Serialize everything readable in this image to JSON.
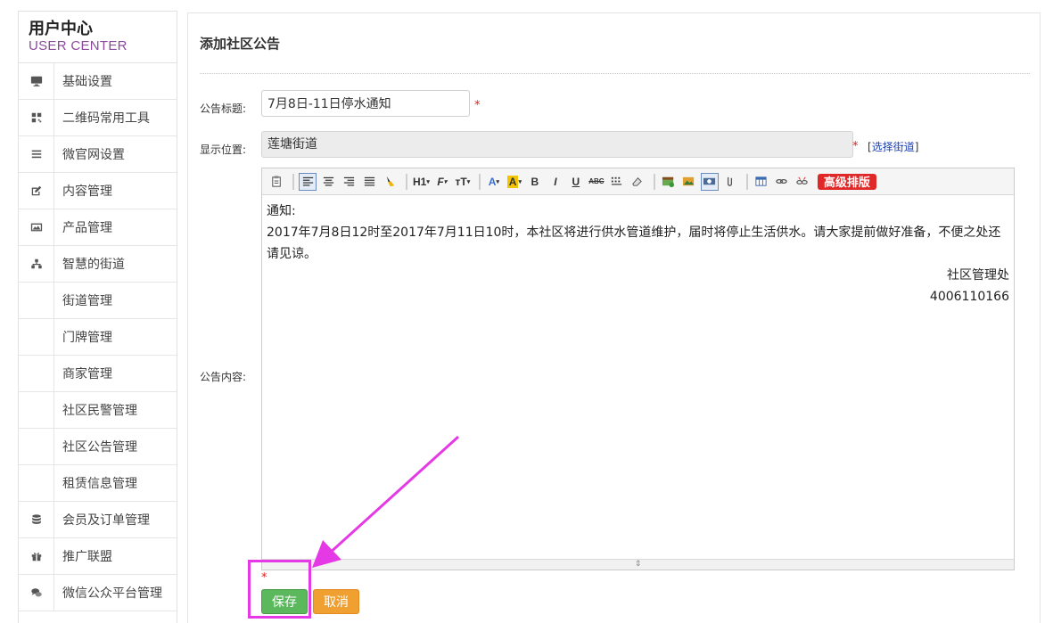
{
  "sidebar": {
    "logo_cn": "用户中心",
    "logo_en": "USER CENTER",
    "items": [
      {
        "label": "基础设置",
        "icon": "monitor-icon"
      },
      {
        "label": "二维码常用工具",
        "icon": "qrcode-icon"
      },
      {
        "label": "微官网设置",
        "icon": "list-icon"
      },
      {
        "label": "内容管理",
        "icon": "edit-icon"
      },
      {
        "label": "产品管理",
        "icon": "image-icon"
      },
      {
        "label": "智慧的街道",
        "icon": "sitemap-icon"
      },
      {
        "label": "街道管理"
      },
      {
        "label": "门牌管理"
      },
      {
        "label": "商家管理"
      },
      {
        "label": "社区民警管理"
      },
      {
        "label": "社区公告管理"
      },
      {
        "label": "租赁信息管理"
      },
      {
        "label": "会员及订单管理",
        "icon": "database-icon"
      },
      {
        "label": "推广联盟",
        "icon": "gift-icon"
      },
      {
        "label": "微信公众平台管理",
        "icon": "comments-icon"
      }
    ]
  },
  "main": {
    "title": "添加社区公告",
    "form": {
      "title_label": "公告标题:",
      "title_value": "7月8日-11日停水通知",
      "location_label": "显示位置:",
      "location_value": "莲塘街道",
      "choose_street_prefix": "[",
      "choose_street": "选择街道",
      "choose_street_suffix": "]",
      "content_label": "公告内容:",
      "required_mark": "*"
    },
    "editor": {
      "toolbar": {
        "h1": "H1",
        "font_size": "тT",
        "font_family": "F",
        "bold": "B",
        "italic": "I",
        "underline": "U",
        "strike": "ABC",
        "font_color": "A",
        "bg_color": "A",
        "advanced": "高级排版"
      },
      "content": {
        "line1": "通知:",
        "line2": "2017年7月8日12时至2017年7月11日10时，本社区将进行供水管道维护，届时将停止生活供水。请大家提前做好准备，不便之处还请见谅。",
        "sign": "社区管理处",
        "phone": "4006110166"
      }
    },
    "buttons": {
      "save": "保存",
      "cancel": "取消"
    }
  },
  "colors": {
    "save": "#5cb85c",
    "cancel": "#f0a030",
    "annotation": "#e639e6",
    "required": "#e02020",
    "link": "#1a3fb0",
    "advanced": "#e02828"
  }
}
